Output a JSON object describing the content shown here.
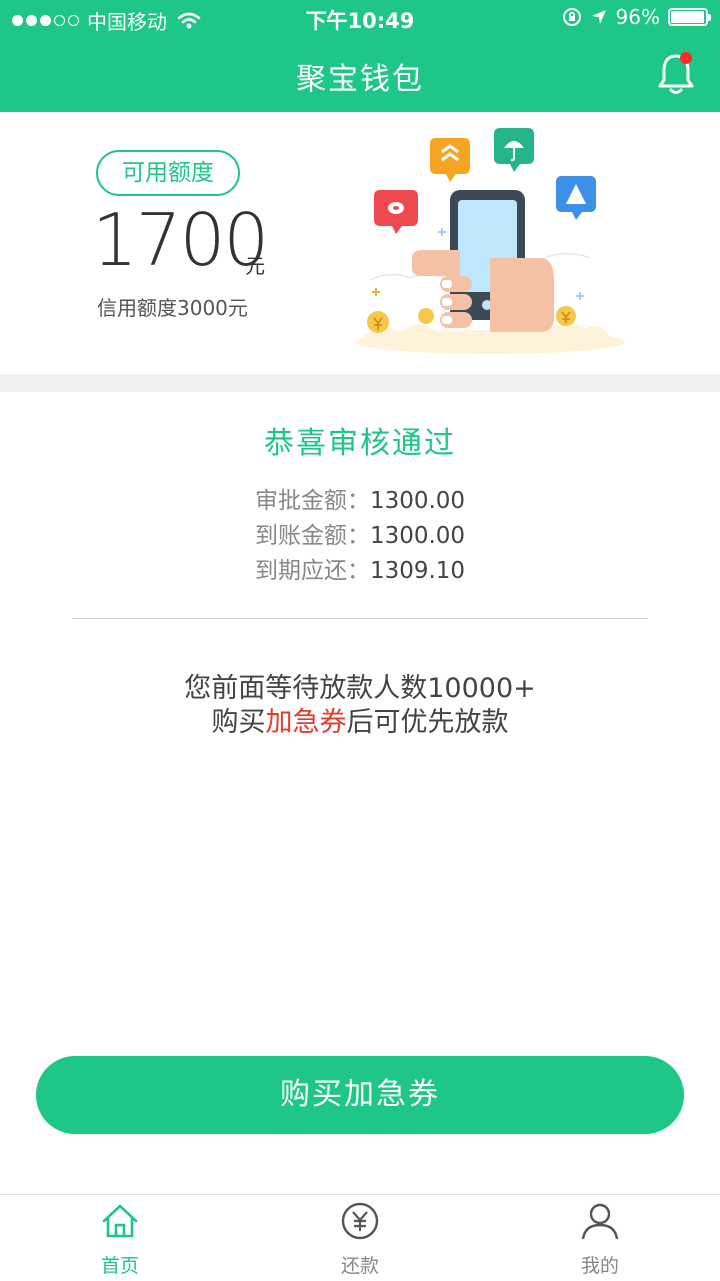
{
  "status_bar": {
    "carrier": "中国移动",
    "time": "下午10:49",
    "battery": "96%",
    "battery_level": 0.96,
    "signal_bars": 3,
    "signal_max": 5
  },
  "nav": {
    "title": "聚宝钱包",
    "has_notification": true
  },
  "credit": {
    "badge": "可用额度",
    "amount": "1700",
    "unit": "元",
    "limit_text": "信用额度3000元"
  },
  "approval": {
    "title": "恭喜审核通过",
    "rows": [
      {
        "label": "审批金额：",
        "value": "1300.00"
      },
      {
        "label": "到账金额：",
        "value": "1300.00"
      },
      {
        "label": "到期应还：",
        "value": "1309.10"
      }
    ]
  },
  "queue": {
    "line1": "您前面等待放款人数10000+",
    "line2_prefix": "购买",
    "line2_highlight": "加急券",
    "line2_suffix": "后可优先放款"
  },
  "button": {
    "label": "购买加急券"
  },
  "tabs": [
    {
      "label": "首页",
      "icon": "home-icon",
      "active": true
    },
    {
      "label": "还款",
      "icon": "yuan-circle-icon",
      "active": false
    },
    {
      "label": "我的",
      "icon": "user-icon",
      "active": false
    }
  ],
  "colors": {
    "brand": "#1ec687",
    "highlight": "#e53b2c",
    "notification": "#ff2a2a"
  }
}
